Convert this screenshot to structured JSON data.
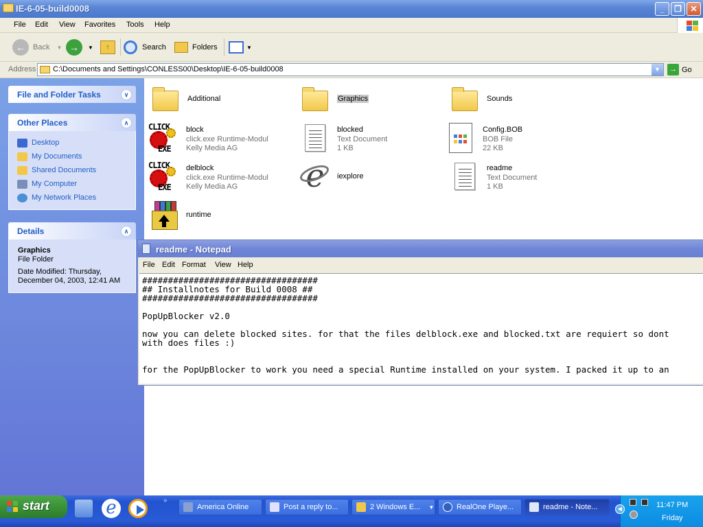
{
  "window": {
    "title": "IE-6-05-build0008",
    "controls": {
      "minimize": "_",
      "restore": "❐",
      "close": "✕"
    }
  },
  "menu": [
    "File",
    "Edit",
    "View",
    "Favorites",
    "Tools",
    "Help"
  ],
  "toolbar": {
    "back": "Back",
    "search": "Search",
    "folders": "Folders"
  },
  "address": {
    "label": "Address",
    "path": "C:\\Documents and Settings\\CONLESS00\\Desktop\\IE-6-05-build0008",
    "go": "Go"
  },
  "sidebar": {
    "file_tasks": {
      "title": "File and Folder Tasks"
    },
    "other_places": {
      "title": "Other Places",
      "items": [
        {
          "label": "Desktop",
          "icon": "desktop-icon",
          "color": "#3a6ad0"
        },
        {
          "label": "My Documents",
          "icon": "my-documents-icon",
          "color": "#f1c84b"
        },
        {
          "label": "Shared Documents",
          "icon": "folder-icon",
          "color": "#f1c84b"
        },
        {
          "label": "My Computer",
          "icon": "computer-icon",
          "color": "#7a8fb8"
        },
        {
          "label": "My Network Places",
          "icon": "network-icon",
          "color": "#4a90d8"
        }
      ]
    },
    "details": {
      "title": "Details",
      "name": "Graphics",
      "type": "File Folder",
      "modified_1": "Date Modified: Thursday,",
      "modified_2": "December 04, 2003, 12:41 AM"
    }
  },
  "files": [
    {
      "name": "Additional",
      "icon": "folder-icon"
    },
    {
      "name": "Graphics",
      "icon": "folder-icon",
      "selected": true
    },
    {
      "name": "Sounds",
      "icon": "folder-icon"
    },
    {
      "name": "block",
      "type": "click.exe Runtime-Modul",
      "extra": "Kelly Media AG",
      "icon": "click-exe-icon"
    },
    {
      "name": "blocked",
      "type": "Text Document",
      "extra": "1 KB",
      "icon": "text-document-icon"
    },
    {
      "name": "Config.BOB",
      "type": "BOB File",
      "extra": "22 KB",
      "icon": "bob-file-icon"
    },
    {
      "name": "delblock",
      "type": "click.exe Runtime-Modul",
      "extra": "Kelly Media AG",
      "icon": "click-exe-icon"
    },
    {
      "name": "iexplore",
      "icon": "internet-explorer-icon"
    },
    {
      "name": "readme",
      "type": "Text Document",
      "extra": "1 KB",
      "icon": "text-document-icon"
    },
    {
      "name": "runtime",
      "icon": "winrar-archive-icon"
    }
  ],
  "click_icon": {
    "top": "CLICK",
    "bottom": "EXE"
  },
  "notepad": {
    "title": "readme - Notepad",
    "menu": [
      "File",
      "Edit",
      "Format",
      "View",
      "Help"
    ],
    "lines": [
      "##################################",
      "## Installnotes for Build 0008 ##",
      "##################################",
      "",
      "PopUpBlocker v2.0",
      "",
      "now you can delete blocked sites. for that the files delblock.exe and blocked.txt are requiert so dont",
      "with does files :)",
      "",
      "",
      "for the PopUpBlocker to work you need a special Runtime installed on your system. I packed it up to an"
    ]
  },
  "taskbar": {
    "start": "start",
    "tasks": [
      {
        "label": "America  Online",
        "color": "#8aa0d0",
        "active": false
      },
      {
        "label": "Post a reply to...",
        "color": "#e0e0ff",
        "active": false
      },
      {
        "label": "2 Windows E...",
        "color": "#f1c84b",
        "active": false
      },
      {
        "label": "RealOne Playe...",
        "color": "#3060c0",
        "active": false
      },
      {
        "label": "readme - Note...",
        "color": "#dfe8f7",
        "active": true
      }
    ],
    "clock": {
      "time": "11:47 PM",
      "day": "Friday"
    }
  }
}
